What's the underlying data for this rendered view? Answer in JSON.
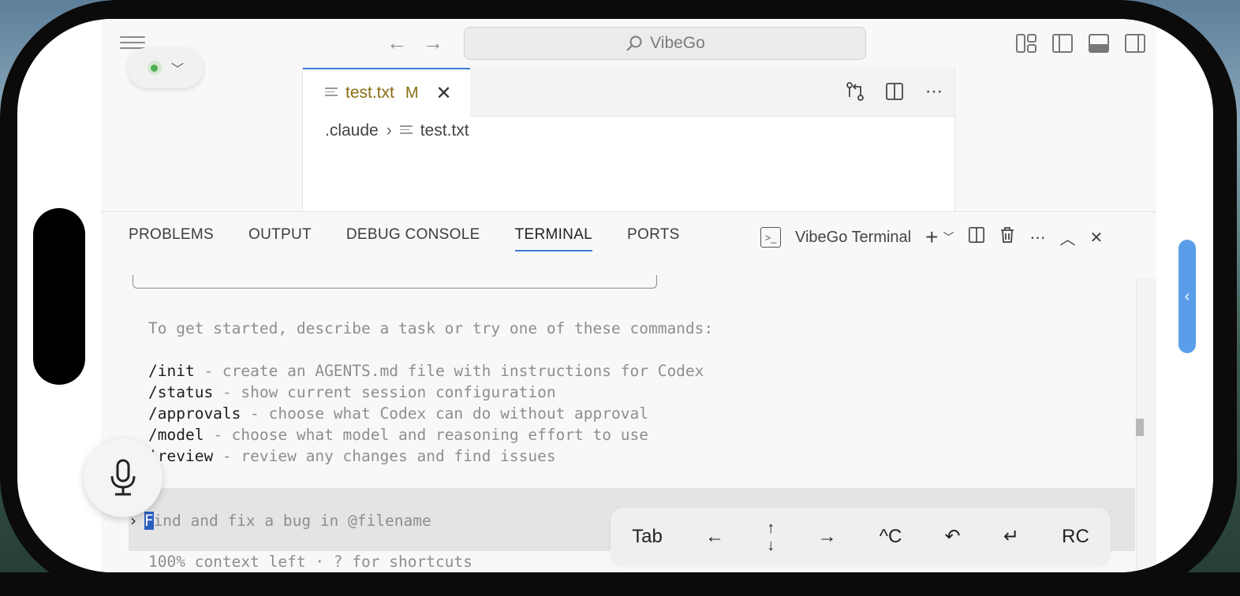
{
  "titlebar": {
    "search_label": "VibeGo",
    "back_icon": "arrow-left-icon",
    "forward_icon": "arrow-right-icon"
  },
  "editor": {
    "tab": {
      "label": "test.txt",
      "modified_flag": "M"
    },
    "breadcrumb": {
      "folder": ".claude",
      "file": "test.txt"
    }
  },
  "panel": {
    "tabs": [
      "PROBLEMS",
      "OUTPUT",
      "DEBUG CONSOLE",
      "TERMINAL",
      "PORTS"
    ],
    "active_tab": "TERMINAL",
    "terminal_name": "VibeGo Terminal"
  },
  "terminal": {
    "intro": "To get started, describe a task or try one of these commands:",
    "commands": [
      {
        "cmd": "/init",
        "desc": " - create an AGENTS.md file with instructions for Codex"
      },
      {
        "cmd": "/status",
        "desc": " - show current session configuration"
      },
      {
        "cmd": "/approvals",
        "desc": " - choose what Codex can do without approval"
      },
      {
        "cmd": "/model",
        "desc": " - choose what model and reasoning effort to use"
      },
      {
        "cmd": "'review",
        "desc": " - review any changes and find issues"
      }
    ],
    "prompt_caret": "›",
    "prompt_first_char": "F",
    "prompt_rest": "ind and fix a bug in @filename",
    "footer": "100% context left · ? for shortcuts"
  },
  "keybar": {
    "tab": "Tab",
    "left": "←",
    "up": "↑",
    "down": "↓",
    "right": "→",
    "ctrl_c": "^C",
    "undo": "↶",
    "enter": "↵",
    "rc": "RC"
  },
  "colors": {
    "accent": "#3b7ad9",
    "modified": "#8a6d12",
    "status_ok": "#4caf50",
    "handle": "#5a9eea"
  }
}
